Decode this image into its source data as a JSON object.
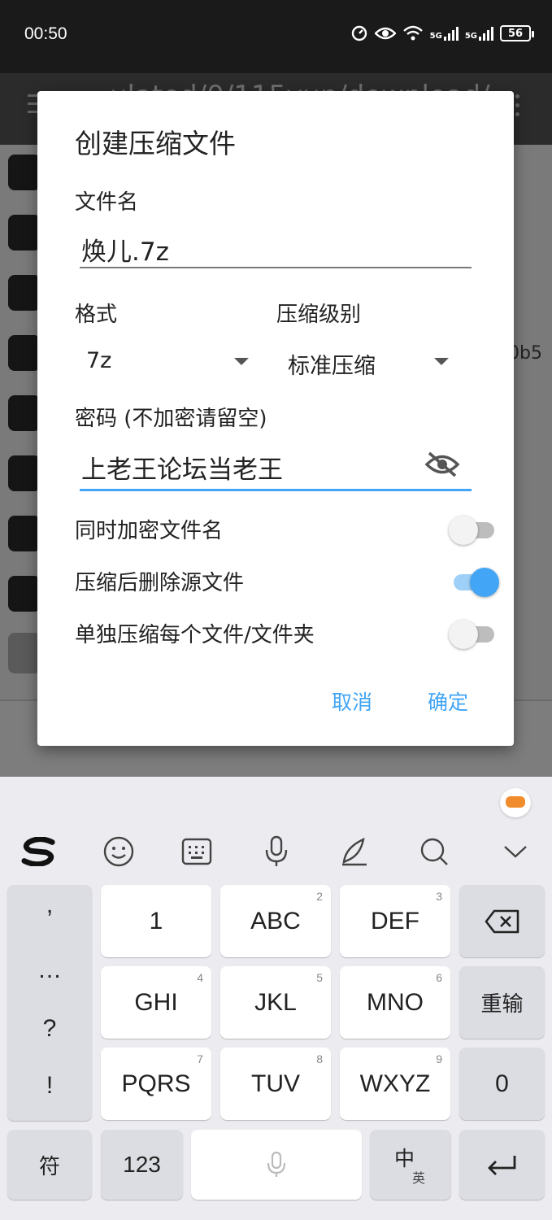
{
  "status_bar": {
    "time": "00:50",
    "signal1": "5G",
    "signal2": "5G",
    "battery": "56"
  },
  "background": {
    "path_text": "ulated/0/115yun/download/",
    "hash_fragment": "0b5"
  },
  "dialog": {
    "title": "创建压缩文件",
    "filename_label": "文件名",
    "filename_value": "焕儿.7z",
    "format_label": "格式",
    "format_value": "7z",
    "level_label": "压缩级别",
    "level_value": "标准压缩",
    "password_label": "密码 (不加密请留空)",
    "password_value": "上老王论坛当老王",
    "options": [
      {
        "label": "同时加密文件名",
        "on": false
      },
      {
        "label": "压缩后删除源文件",
        "on": true
      },
      {
        "label": "单独压缩每个文件/文件夹",
        "on": false
      }
    ],
    "cancel_label": "取消",
    "ok_label": "确定"
  },
  "keyboard": {
    "punct": [
      ",",
      "…",
      "?",
      "!"
    ],
    "keys": [
      {
        "label": "1",
        "num": ""
      },
      {
        "label": "ABC",
        "num": "2"
      },
      {
        "label": "DEF",
        "num": "3"
      },
      {
        "label": "GHI",
        "num": "4"
      },
      {
        "label": "JKL",
        "num": "5"
      },
      {
        "label": "MNO",
        "num": "6"
      },
      {
        "label": "PQRS",
        "num": "7"
      },
      {
        "label": "TUV",
        "num": "8"
      },
      {
        "label": "WXYZ",
        "num": "9"
      }
    ],
    "reenter_label": "重输",
    "zero_label": "0",
    "symbol_label": "符",
    "num_label": "123",
    "lang_main": "中",
    "lang_sub": "英"
  }
}
